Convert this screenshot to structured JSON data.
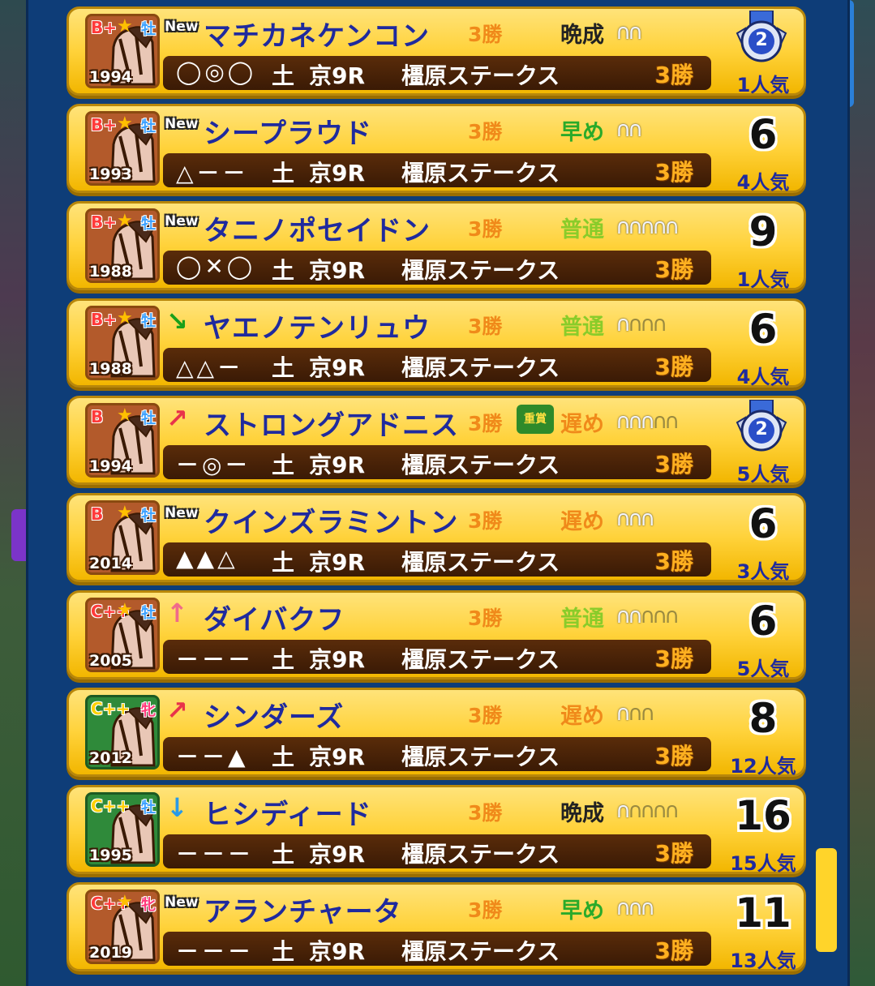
{
  "horses": [
    {
      "rank": "B+",
      "sex": "牡",
      "year": "1994",
      "new": true,
      "trend": "",
      "name": "マチカネケンコン",
      "wins": "3勝",
      "graded": "",
      "style": "晩成",
      "style_color": "#222222",
      "shoes_on": 2,
      "shoes_total": 2,
      "marks": "◯◎◯",
      "day": "土",
      "course": "京9R",
      "race": "橿原ステークス",
      "class": "3勝",
      "odds": "2",
      "medal": true,
      "popularity": "1人気",
      "green": false
    },
    {
      "rank": "B+",
      "sex": "牡",
      "year": "1993",
      "new": true,
      "trend": "",
      "name": "シープラウド",
      "wins": "3勝",
      "graded": "",
      "style": "早め",
      "style_color": "#2aaa2a",
      "shoes_on": 2,
      "shoes_total": 2,
      "marks": "△－－",
      "day": "土",
      "course": "京9R",
      "race": "橿原ステークス",
      "class": "3勝",
      "odds": "6",
      "medal": false,
      "popularity": "4人気",
      "green": false
    },
    {
      "rank": "B+",
      "sex": "牡",
      "year": "1988",
      "new": true,
      "trend": "",
      "name": "タニノポセイドン",
      "wins": "3勝",
      "graded": "",
      "style": "普通",
      "style_color": "#8acc2a",
      "shoes_on": 5,
      "shoes_total": 5,
      "marks": "◯✕◯",
      "day": "土",
      "course": "京9R",
      "race": "橿原ステークス",
      "class": "3勝",
      "odds": "9",
      "medal": false,
      "popularity": "1人気",
      "green": false
    },
    {
      "rank": "B+",
      "sex": "牡",
      "year": "1988",
      "new": false,
      "trend": "↘",
      "trend_color": "#1aa01a",
      "name": "ヤエノテンリュウ",
      "wins": "3勝",
      "graded": "",
      "style": "普通",
      "style_color": "#8acc2a",
      "shoes_on": 1,
      "shoes_total": 4,
      "marks": "△△－",
      "day": "土",
      "course": "京9R",
      "race": "橿原ステークス",
      "class": "3勝",
      "odds": "6",
      "medal": false,
      "popularity": "4人気",
      "green": false
    },
    {
      "rank": "B",
      "sex": "牡",
      "year": "1994",
      "new": false,
      "trend": "↗",
      "trend_color": "#e8334a",
      "name": "ストロングアドニス",
      "wins": "3勝",
      "graded": "重賞",
      "style": "遅め",
      "style_color": "#f08a1a",
      "shoes_on": 3,
      "shoes_total": 5,
      "marks": "－◎－",
      "day": "土",
      "course": "京9R",
      "race": "橿原ステークス",
      "class": "3勝",
      "odds": "2",
      "medal": true,
      "popularity": "5人気",
      "green": false
    },
    {
      "rank": "B",
      "sex": "牡",
      "year": "2014",
      "new": true,
      "trend": "",
      "name": "クインズラミントン",
      "wins": "3勝",
      "graded": "",
      "style": "遅め",
      "style_color": "#f08a1a",
      "shoes_on": 3,
      "shoes_total": 3,
      "marks": "▲▲△",
      "day": "土",
      "course": "京9R",
      "race": "橿原ステークス",
      "class": "3勝",
      "odds": "6",
      "medal": false,
      "popularity": "3人気",
      "green": false
    },
    {
      "rank": "C++",
      "sex": "牡",
      "year": "2005",
      "new": false,
      "trend": "↑",
      "trend_color": "#f06a8a",
      "name": "ダイバクフ",
      "wins": "3勝",
      "graded": "",
      "style": "普通",
      "style_color": "#8acc2a",
      "shoes_on": 2,
      "shoes_total": 5,
      "marks": "－－－",
      "day": "土",
      "course": "京9R",
      "race": "橿原ステークス",
      "class": "3勝",
      "odds": "6",
      "medal": false,
      "popularity": "5人気",
      "green": false
    },
    {
      "rank": "C++",
      "sex": "牝",
      "year": "2012",
      "new": false,
      "trend": "↗",
      "trend_color": "#e8334a",
      "name": "シンダーズ",
      "wins": "3勝",
      "graded": "",
      "style": "遅め",
      "style_color": "#f08a1a",
      "shoes_on": 1,
      "shoes_total": 3,
      "marks": "－－▲",
      "day": "土",
      "course": "京9R",
      "race": "橿原ステークス",
      "class": "3勝",
      "odds": "8",
      "medal": false,
      "popularity": "12人気",
      "green": true
    },
    {
      "rank": "C++",
      "sex": "牡",
      "year": "1995",
      "new": false,
      "trend": "↓",
      "trend_color": "#2a9ae8",
      "name": "ヒシディード",
      "wins": "3勝",
      "graded": "",
      "style": "晩成",
      "style_color": "#222222",
      "shoes_on": 1,
      "shoes_total": 5,
      "marks": "－－－",
      "day": "土",
      "course": "京9R",
      "race": "橿原ステークス",
      "class": "3勝",
      "odds": "16",
      "medal": false,
      "popularity": "15人気",
      "green": true
    },
    {
      "rank": "C++",
      "sex": "牝",
      "year": "2019",
      "new": true,
      "trend": "",
      "name": "アランチャータ",
      "wins": "3勝",
      "graded": "",
      "style": "早め",
      "style_color": "#2aaa2a",
      "shoes_on": 3,
      "shoes_total": 3,
      "marks": "－－－",
      "day": "土",
      "course": "京9R",
      "race": "橿原ステークス",
      "class": "3勝",
      "odds": "11",
      "medal": false,
      "popularity": "13人気",
      "green": false
    }
  ],
  "new_label": "New"
}
